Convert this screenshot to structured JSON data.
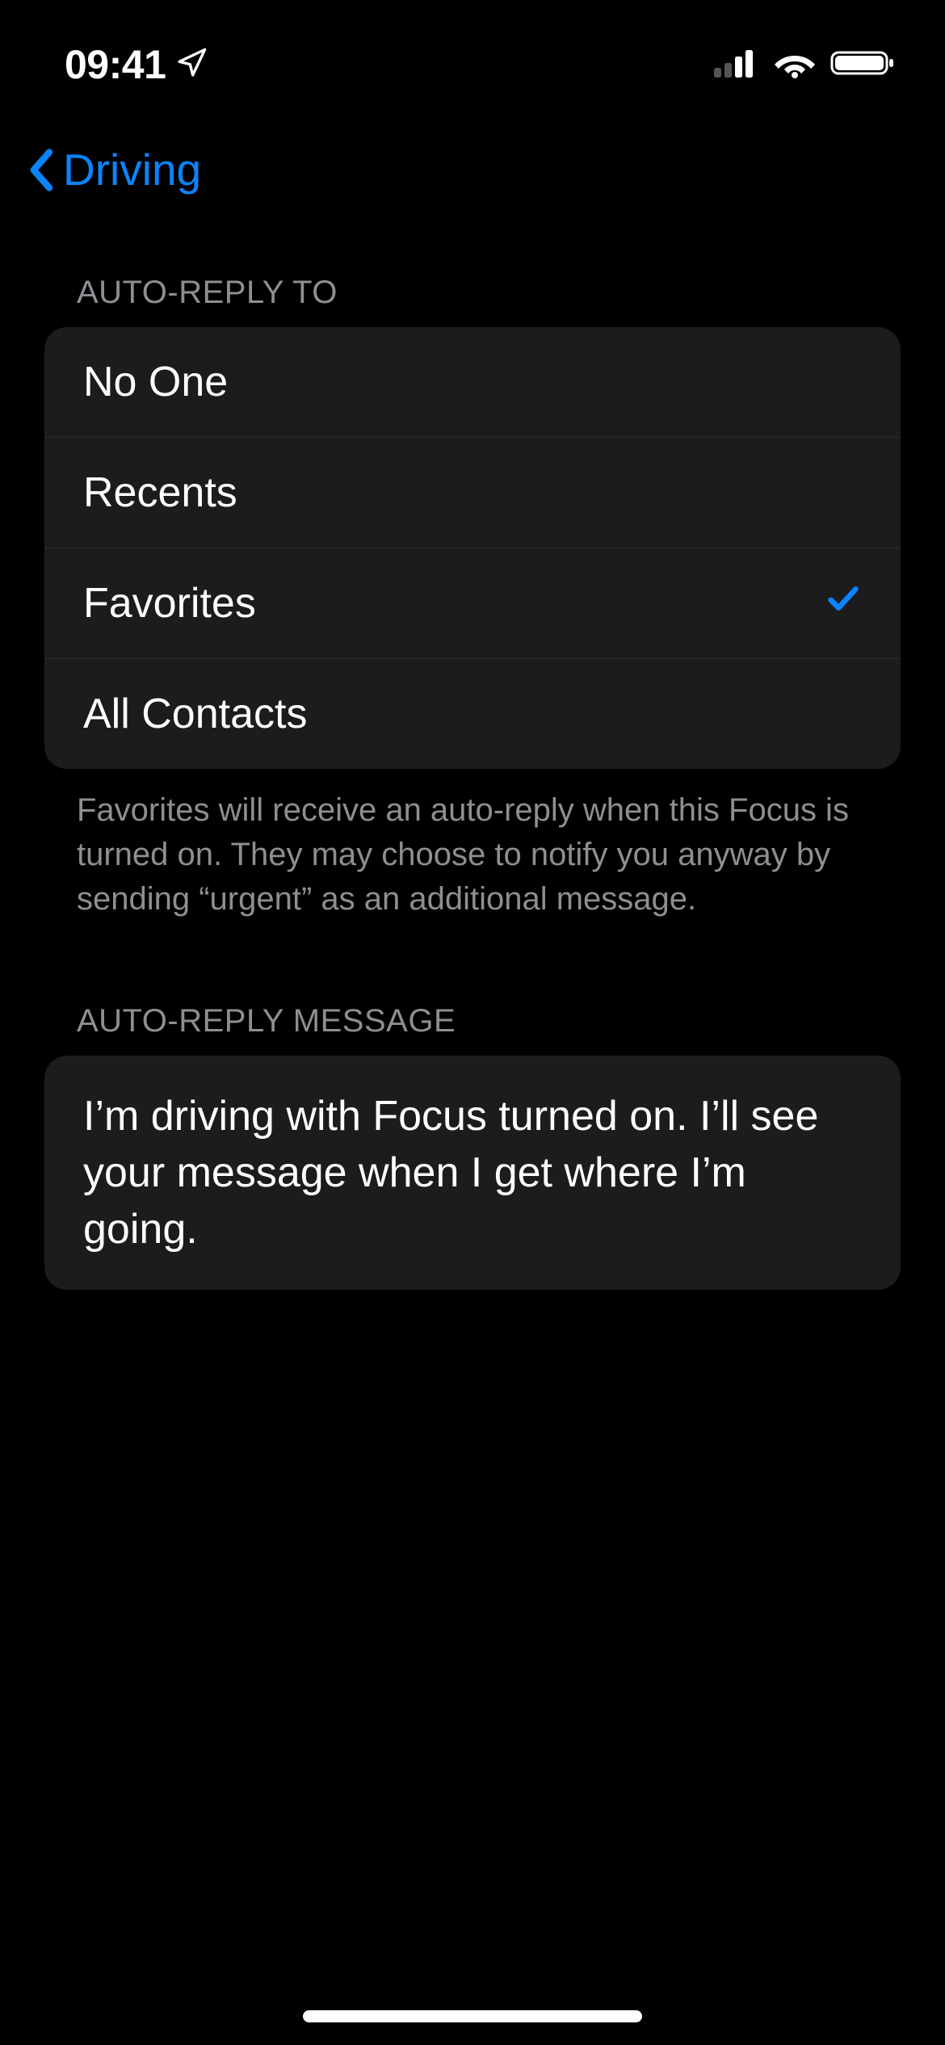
{
  "status_bar": {
    "time": "09:41"
  },
  "nav": {
    "back_label": "Driving"
  },
  "sections": {
    "auto_reply_to": {
      "header": "Auto-Reply To",
      "items": [
        {
          "label": "No One",
          "selected": false
        },
        {
          "label": "Recents",
          "selected": false
        },
        {
          "label": "Favorites",
          "selected": true
        },
        {
          "label": "All Contacts",
          "selected": false
        }
      ],
      "footer": "Favorites will receive an auto-reply when this Focus is turned on. They may choose to notify you anyway by sending “urgent” as an additional message."
    },
    "auto_reply_message": {
      "header": "Auto-Reply Message",
      "message": "I’m driving with Focus turned on. I’ll see your message when I get where I’m going."
    }
  }
}
